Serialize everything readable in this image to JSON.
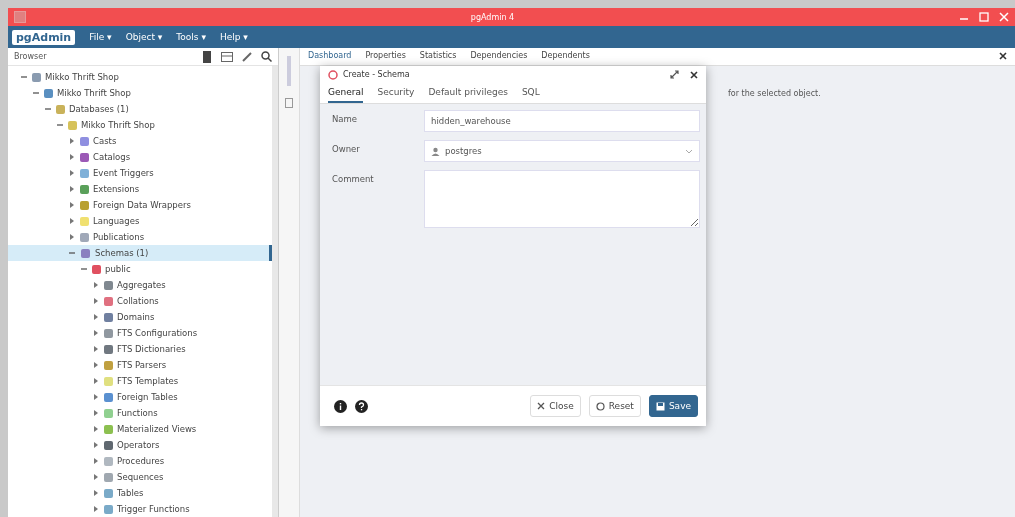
{
  "window": {
    "title": "pgAdmin 4"
  },
  "menu": {
    "logo": "pgAdmin",
    "items": [
      "File ▾",
      "Object ▾",
      "Tools ▾",
      "Help ▾"
    ]
  },
  "browser": {
    "title": "Browser",
    "tree": [
      {
        "label": "Mikko Thrift Shop",
        "color": "#8a9bb0",
        "expanded": true,
        "selected": false,
        "children": [
          {
            "label": "Mikko Thrift Shop",
            "color": "#5a8fc0",
            "expanded": true,
            "selected": false,
            "children": [
              {
                "label": "Databases (1)",
                "color": "#c9b25a",
                "expanded": true,
                "selected": false,
                "children": [
                  {
                    "label": "Mikko Thrift Shop",
                    "color": "#d6c25a",
                    "expanded": true,
                    "selected": false,
                    "children": [
                      {
                        "label": "Casts",
                        "color": "#8f8fe0",
                        "expanded": false,
                        "selected": false
                      },
                      {
                        "label": "Catalogs",
                        "color": "#9b59b6",
                        "expanded": false,
                        "selected": false
                      },
                      {
                        "label": "Event Triggers",
                        "color": "#7fb0d8",
                        "expanded": false,
                        "selected": false
                      },
                      {
                        "label": "Extensions",
                        "color": "#5aa05a",
                        "expanded": false,
                        "selected": false
                      },
                      {
                        "label": "Foreign Data Wrappers",
                        "color": "#b8a030",
                        "expanded": false,
                        "selected": false
                      },
                      {
                        "label": "Languages",
                        "color": "#f0e070",
                        "expanded": false,
                        "selected": false
                      },
                      {
                        "label": "Publications",
                        "color": "#a0a8b8",
                        "expanded": false,
                        "selected": false
                      },
                      {
                        "label": "Schemas (1)",
                        "color": "#8a80c0",
                        "expanded": true,
                        "selected": true,
                        "children": [
                          {
                            "label": "public",
                            "color": "#e05060",
                            "expanded": true,
                            "selected": false,
                            "children": [
                              {
                                "label": "Aggregates",
                                "color": "#808890",
                                "expanded": false,
                                "selected": false
                              },
                              {
                                "label": "Collations",
                                "color": "#e07080",
                                "expanded": false,
                                "selected": false
                              },
                              {
                                "label": "Domains",
                                "color": "#7080a0",
                                "expanded": false,
                                "selected": false
                              },
                              {
                                "label": "FTS Configurations",
                                "color": "#9098a0",
                                "expanded": false,
                                "selected": false
                              },
                              {
                                "label": "FTS Dictionaries",
                                "color": "#707880",
                                "expanded": false,
                                "selected": false
                              },
                              {
                                "label": "FTS Parsers",
                                "color": "#c0a040",
                                "expanded": false,
                                "selected": false
                              },
                              {
                                "label": "FTS Templates",
                                "color": "#e0e080",
                                "expanded": false,
                                "selected": false
                              },
                              {
                                "label": "Foreign Tables",
                                "color": "#5a90d0",
                                "expanded": false,
                                "selected": false
                              },
                              {
                                "label": "Functions",
                                "color": "#90d090",
                                "expanded": false,
                                "selected": false
                              },
                              {
                                "label": "Materialized Views",
                                "color": "#8cc050",
                                "expanded": false,
                                "selected": false
                              },
                              {
                                "label": "Operators",
                                "color": "#606870",
                                "expanded": false,
                                "selected": false
                              },
                              {
                                "label": "Procedures",
                                "color": "#b0b8c0",
                                "expanded": false,
                                "selected": false
                              },
                              {
                                "label": "Sequences",
                                "color": "#a0a8b0",
                                "expanded": false,
                                "selected": false
                              },
                              {
                                "label": "Tables",
                                "color": "#7aaac8",
                                "expanded": false,
                                "selected": false
                              },
                              {
                                "label": "Trigger Functions",
                                "color": "#7aaac8",
                                "expanded": false,
                                "selected": false
                              }
                            ]
                          }
                        ]
                      }
                    ]
                  }
                ]
              }
            ]
          }
        ]
      }
    ]
  },
  "main": {
    "tabs": [
      {
        "label": "Dashboard",
        "selected": true
      },
      {
        "label": "Properties",
        "selected": false
      },
      {
        "label": "Statistics",
        "selected": false
      },
      {
        "label": "Dependencies",
        "selected": false
      },
      {
        "label": "Dependents",
        "selected": false
      }
    ],
    "message": "for the selected object."
  },
  "dialog": {
    "title": "Create - Schema",
    "tabs": [
      {
        "label": "General",
        "selected": true
      },
      {
        "label": "Security",
        "selected": false
      },
      {
        "label": "Default privileges",
        "selected": false
      },
      {
        "label": "SQL",
        "selected": false
      }
    ],
    "fields": [
      {
        "label": "Name",
        "kind": "text",
        "value": "hidden_warehouse"
      },
      {
        "label": "Owner",
        "kind": "select",
        "value": "postgres"
      },
      {
        "label": "Comment",
        "kind": "textarea"
      }
    ],
    "buttons": [
      {
        "label": "Close",
        "kind": "close"
      },
      {
        "label": "Reset",
        "kind": "reset"
      },
      {
        "label": "Save",
        "kind": "save"
      }
    ]
  }
}
